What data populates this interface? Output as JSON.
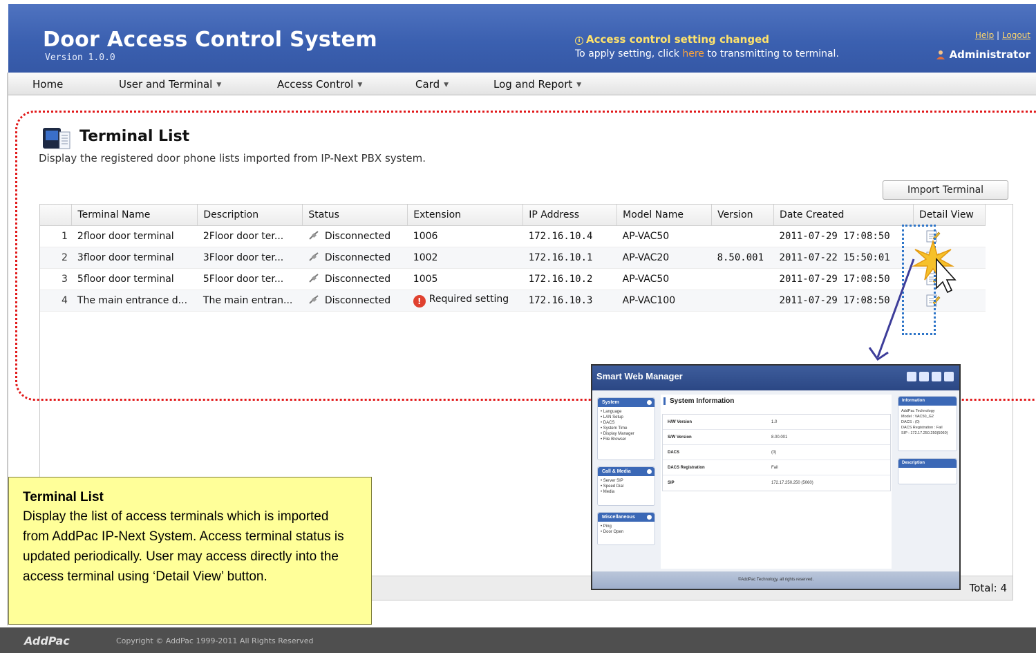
{
  "header": {
    "title": "Door Access Control System",
    "version": "Version 1.0.0",
    "notice_title": "Access control setting changed",
    "notice_prefix": "To apply setting, click ",
    "notice_link": "here",
    "notice_suffix": " to transmitting to terminal.",
    "help": "Help",
    "separator": "|",
    "logout": "Logout",
    "user": "Administrator"
  },
  "menu": {
    "home": "Home",
    "user_terminal": "User and Terminal",
    "access_control": "Access Control",
    "card": "Card",
    "log_report": "Log and Report"
  },
  "panel": {
    "title": "Terminal List",
    "description": "Display the registered door phone lists imported from IP-Next PBX system.",
    "import_button": "Import Terminal"
  },
  "table": {
    "columns": [
      "",
      "Terminal Name",
      "Description",
      "Status",
      "Extension",
      "IP Address",
      "Model Name",
      "Version",
      "Date Created",
      "Detail View"
    ],
    "rows": [
      {
        "no": "1",
        "name": "2floor door terminal",
        "desc": "2Floor door ter...",
        "status": "Disconnected",
        "ext": "1006",
        "ip": "172.16.10.4",
        "model": "AP-VAC50",
        "version": "",
        "date": "2011-07-29 17:08:50"
      },
      {
        "no": "2",
        "name": "3floor door terminal",
        "desc": "3Floor door ter...",
        "status": "Disconnected",
        "ext": "1002",
        "ip": "172.16.10.1",
        "model": "AP-VAC20",
        "version": "8.50.001",
        "date": "2011-07-22 15:50:01"
      },
      {
        "no": "3",
        "name": "5floor door terminal",
        "desc": "5Floor door ter...",
        "status": "Disconnected",
        "ext": "1005",
        "ip": "172.16.10.2",
        "model": "AP-VAC50",
        "version": "",
        "date": "2011-07-29 17:08:50"
      },
      {
        "no": "4",
        "name": "The main entrance d...",
        "desc": "The main entran...",
        "status": "Disconnected",
        "ext": "Required setting",
        "ip": "172.16.10.3",
        "model": "AP-VAC100",
        "version": "",
        "date": "2011-07-29 17:08:50"
      }
    ],
    "total": "Total: 4"
  },
  "callout": {
    "title": "Terminal List",
    "body": "Display the list of access terminals which is imported from AddPac IP-Next System. Access terminal status is updated periodically. User may access directly into the access terminal using ‘Detail View’ button."
  },
  "popup": {
    "brand": "Smart Web Manager",
    "sidebar": [
      {
        "title": "System",
        "items": [
          "• Language",
          "• LAN Setup",
          "• DACS",
          "• System Time",
          "• Display Manager",
          "• File Browser"
        ]
      },
      {
        "title": "Call & Media",
        "items": [
          "• Server SIP",
          "• Speed Dial",
          "• Media"
        ]
      },
      {
        "title": "Miscellaneous",
        "items": [
          "• Ping",
          "• Door Open"
        ]
      }
    ],
    "main_title": "System Information",
    "info_rows": [
      {
        "k": "H/W Version",
        "v": "1.0"
      },
      {
        "k": "S/W Version",
        "v": "8.00.001"
      },
      {
        "k": "DACS",
        "v": "(0)"
      },
      {
        "k": "DACS Registration",
        "v": "Fail"
      },
      {
        "k": "SIP",
        "v": "172.17.250.250 (5060)"
      }
    ],
    "info_box_title": "Information",
    "info_box_lines": [
      "AddPac Technology",
      "Model : VAC50_G2",
      "DACS : (0)",
      "DACS Registration : Fail",
      "SIP : 172.17.250.250(5060)"
    ],
    "desc_box_title": "Description",
    "footer": "©AddPac Technology, all rights reserved."
  },
  "footer": {
    "logo": "AddPac",
    "copyright": "Copyright © AddPac 1999-2011 All Rights Reserved"
  },
  "colors": {
    "header_blue": "#3b60b0",
    "notice_yellow": "#ffe36b",
    "highlight_red": "#e1191a",
    "callout_yellow": "#ffff99",
    "detail_blue": "#2e75c8"
  }
}
